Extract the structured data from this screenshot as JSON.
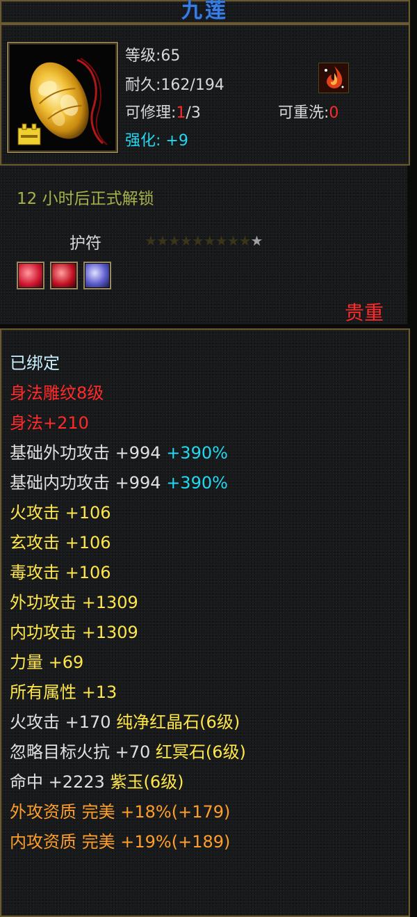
{
  "item": {
    "name": "九莲",
    "level_label": "等级:65",
    "durability_label": "耐久:162/194",
    "repair_label": "可修理:",
    "repair_value": "1",
    "repair_total": "/3",
    "rewash_label": "可重洗:",
    "rewash_value": "0",
    "enhance_label": "强化:",
    "enhance_value": "+9"
  },
  "unlock_text": "12 小时后正式解锁",
  "amulet_label": "护符",
  "stars": {
    "total": 10,
    "filled_silver": 1
  },
  "precious_label": "贵重",
  "attributes": [
    {
      "parts": [
        {
          "t": "已绑定",
          "c": "pale-cyan"
        }
      ]
    },
    {
      "parts": [
        {
          "t": "身法雕纹8级",
          "c": "red"
        }
      ]
    },
    {
      "parts": [
        {
          "t": "身法+210",
          "c": "red"
        }
      ]
    },
    {
      "parts": [
        {
          "t": "基础外功攻击 ",
          "c": "white"
        },
        {
          "t": "+994",
          "c": "white"
        },
        {
          "t": " +390%",
          "c": "cyan"
        }
      ]
    },
    {
      "parts": [
        {
          "t": "基础内功攻击 ",
          "c": "white"
        },
        {
          "t": "+994",
          "c": "white"
        },
        {
          "t": " +390%",
          "c": "cyan"
        }
      ]
    },
    {
      "parts": [
        {
          "t": "火攻击 ",
          "c": "yellow"
        },
        {
          "t": "+106",
          "c": "yellow"
        }
      ]
    },
    {
      "parts": [
        {
          "t": "玄攻击 ",
          "c": "yellow"
        },
        {
          "t": "+106",
          "c": "yellow"
        }
      ]
    },
    {
      "parts": [
        {
          "t": "毒攻击 ",
          "c": "yellow"
        },
        {
          "t": "+106",
          "c": "yellow"
        }
      ]
    },
    {
      "parts": [
        {
          "t": "外功攻击 ",
          "c": "yellow"
        },
        {
          "t": "+1309",
          "c": "yellow"
        }
      ]
    },
    {
      "parts": [
        {
          "t": "内功攻击 ",
          "c": "yellow"
        },
        {
          "t": "+1309",
          "c": "yellow"
        }
      ]
    },
    {
      "parts": [
        {
          "t": "力量 ",
          "c": "yellow"
        },
        {
          "t": "+69",
          "c": "yellow"
        }
      ]
    },
    {
      "parts": [
        {
          "t": "所有属性 ",
          "c": "yellow"
        },
        {
          "t": "+13",
          "c": "yellow"
        }
      ]
    },
    {
      "parts": [
        {
          "t": "火攻击 ",
          "c": "white"
        },
        {
          "t": "+170 ",
          "c": "white"
        },
        {
          "t": "纯净红晶石(6级)",
          "c": "yellow"
        }
      ]
    },
    {
      "parts": [
        {
          "t": "忽略目标火抗 ",
          "c": "white"
        },
        {
          "t": "+70 ",
          "c": "white"
        },
        {
          "t": "红冥石(6级)",
          "c": "yellow"
        }
      ]
    },
    {
      "parts": [
        {
          "t": "命中 ",
          "c": "white"
        },
        {
          "t": "+2223 ",
          "c": "white"
        },
        {
          "t": "紫玉(6级)",
          "c": "yellow"
        }
      ]
    },
    {
      "parts": [
        {
          "t": "外攻资质  ",
          "c": "orange"
        },
        {
          "t": "完美 ",
          "c": "orange"
        },
        {
          "t": "+18%(+179)",
          "c": "orange"
        }
      ]
    },
    {
      "parts": [
        {
          "t": "内攻资质  ",
          "c": "orange"
        },
        {
          "t": "完美 ",
          "c": "orange"
        },
        {
          "t": "+19%(+189)",
          "c": "orange"
        }
      ]
    }
  ]
}
